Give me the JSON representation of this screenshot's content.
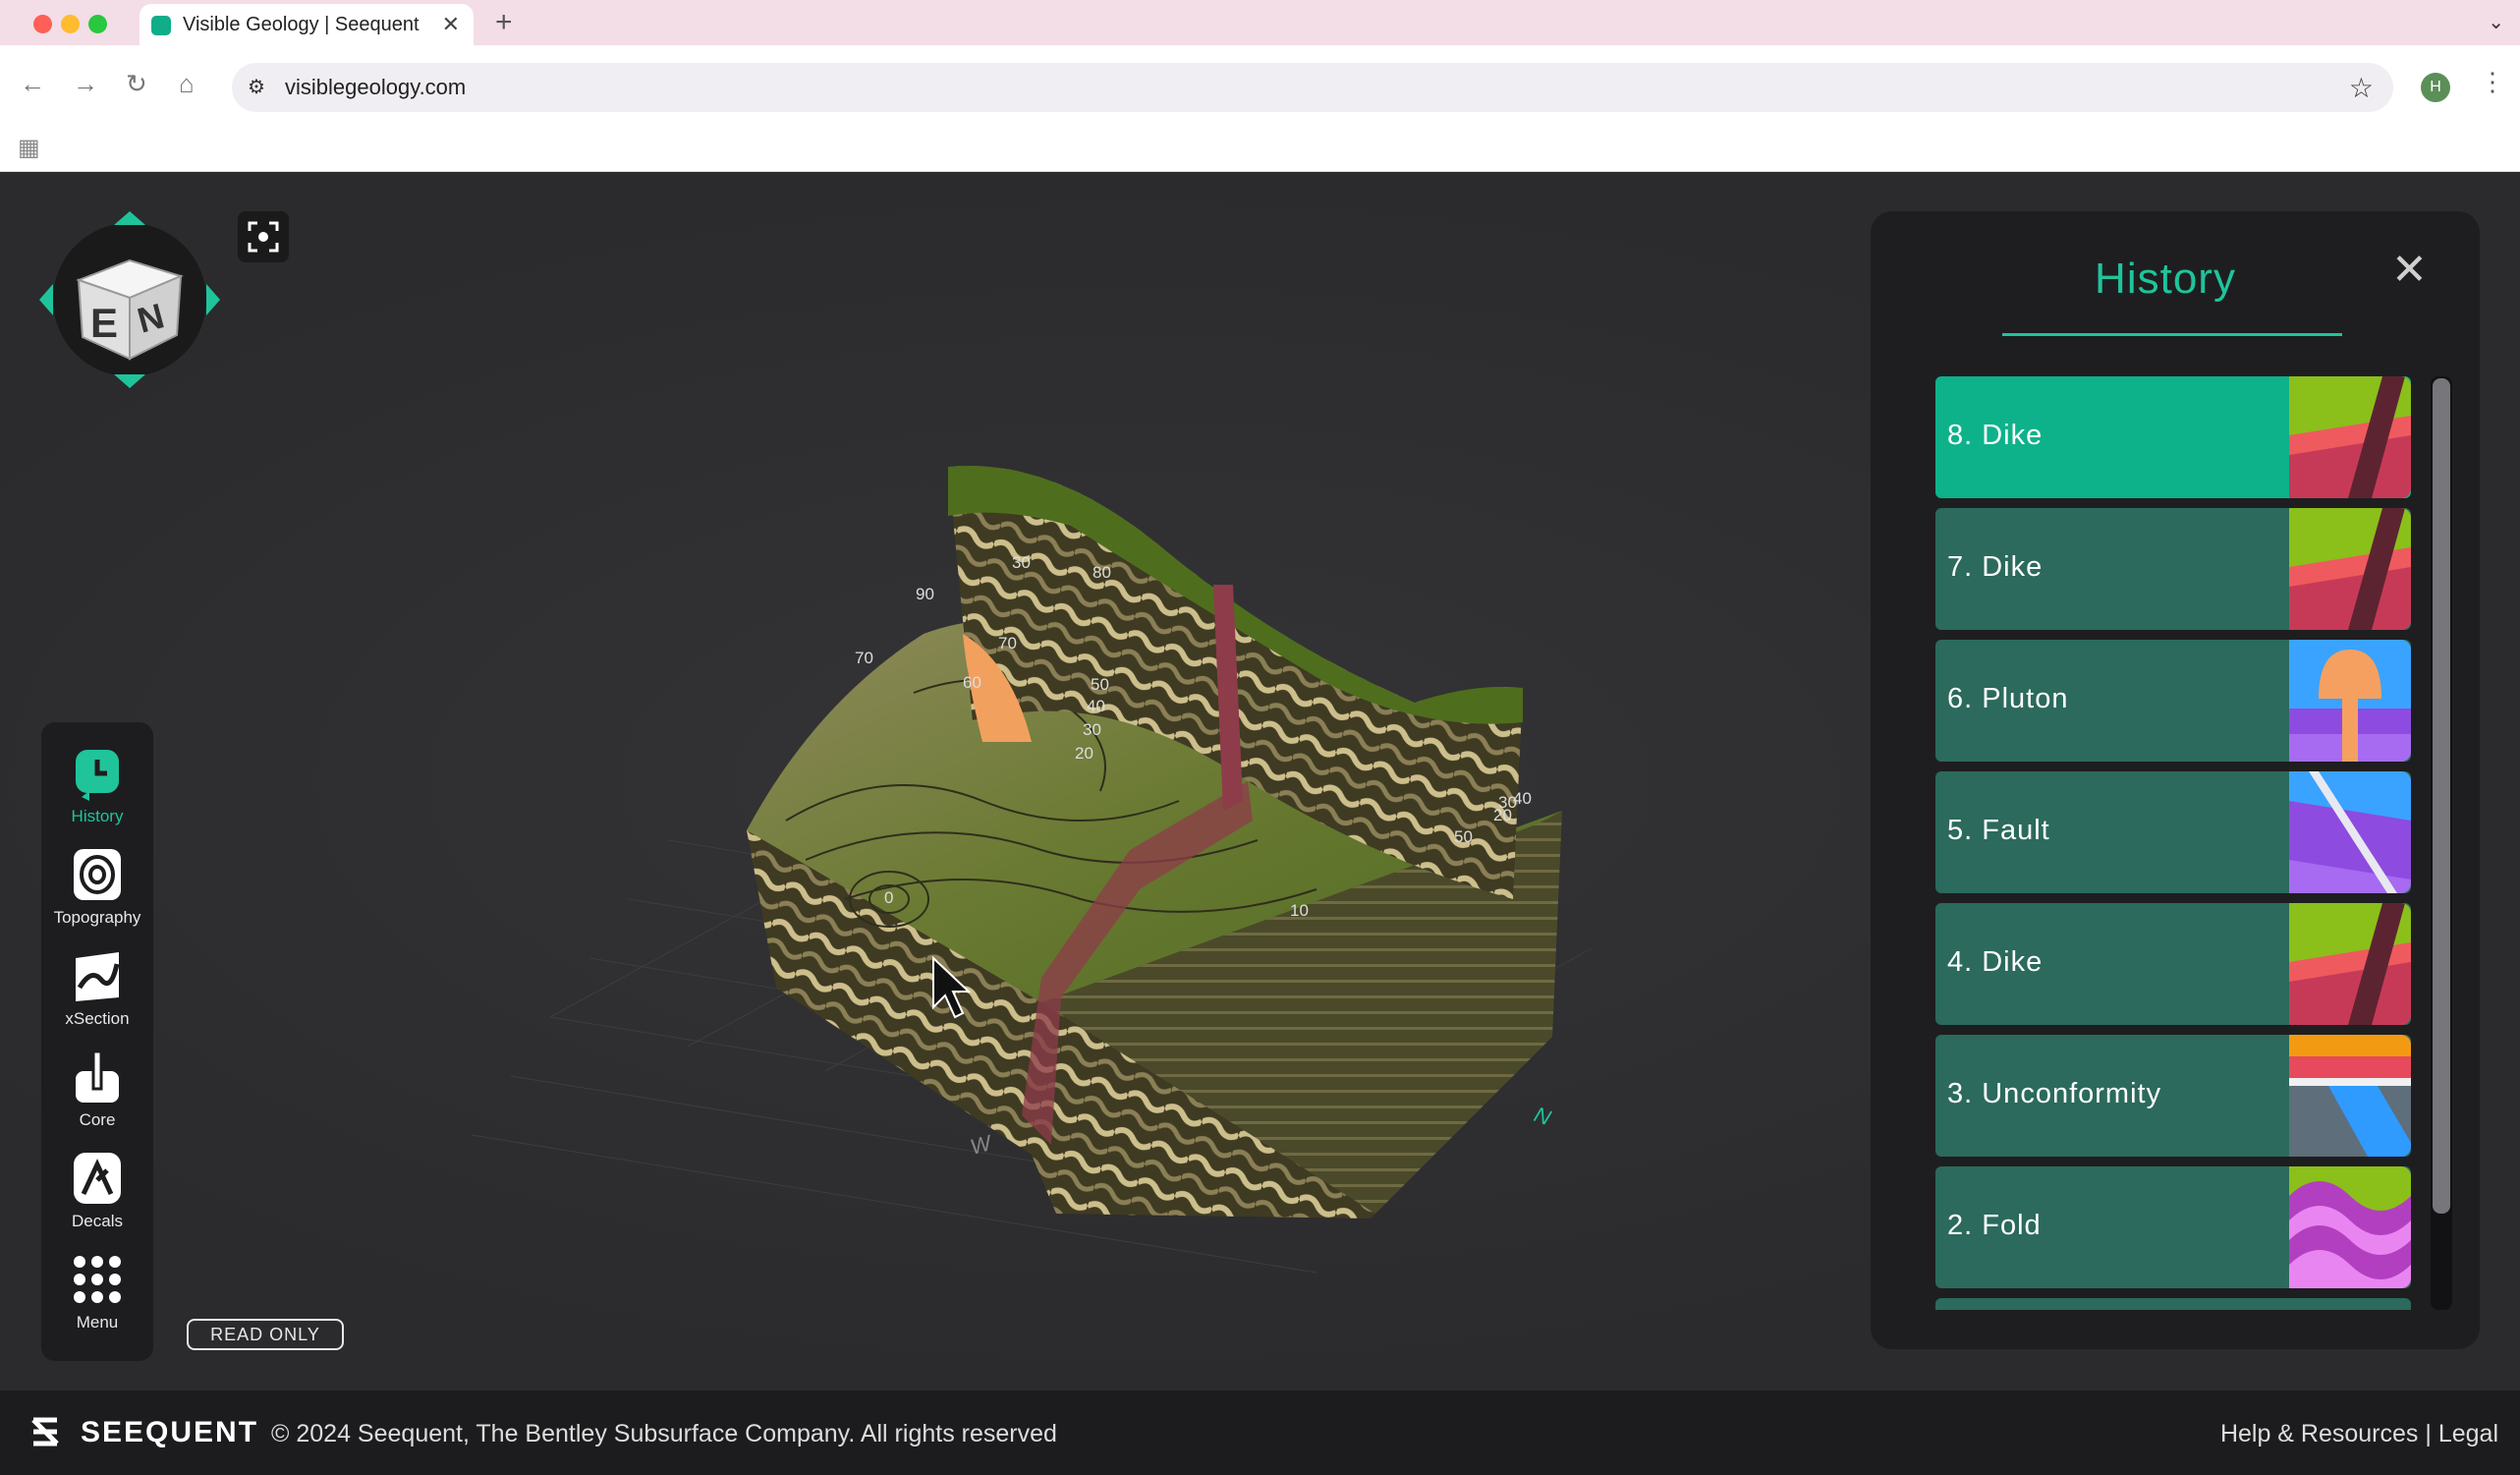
{
  "browser": {
    "tab_title": "Visible Geology | Seequent",
    "tab_close_glyph": "✕",
    "new_tab_glyph": "+",
    "url": "visiblegeology.com",
    "profile_initial": "H",
    "icons": [
      "back-arrow-icon",
      "forward-arrow-icon",
      "reload-icon",
      "home-icon",
      "site-info-icon",
      "star-icon",
      "kebab-menu-icon",
      "apps-grid-icon"
    ]
  },
  "tools": [
    {
      "label": "History",
      "icon": "history-icon",
      "active": true
    },
    {
      "label": "Topography",
      "icon": "topography-icon"
    },
    {
      "label": "xSection",
      "icon": "xsection-icon"
    },
    {
      "label": "Core",
      "icon": "core-icon"
    },
    {
      "label": "Decals",
      "icon": "decals-icon"
    },
    {
      "label": "Menu",
      "icon": "menu-dots-icon"
    }
  ],
  "compass": {
    "faces": [
      "E",
      "N"
    ]
  },
  "scene": {
    "contour_labels": [
      "90",
      "70",
      "70",
      "60",
      "50",
      "40",
      "30",
      "20",
      "80",
      "10",
      "0",
      "50",
      "20",
      "40",
      "30",
      "30"
    ],
    "axis_labels": {
      "west": "W",
      "north": "N"
    }
  },
  "read_only_label": "READ ONLY",
  "history_panel": {
    "title": "History",
    "close_glyph": "✕",
    "items": [
      {
        "label": "8. Dike",
        "kind": "dike",
        "active": true
      },
      {
        "label": "7. Dike",
        "kind": "dike"
      },
      {
        "label": "6. Pluton",
        "kind": "pluton"
      },
      {
        "label": "5. Fault",
        "kind": "fault"
      },
      {
        "label": "4. Dike",
        "kind": "dike"
      },
      {
        "label": "3. Unconformity",
        "kind": "unconformity"
      },
      {
        "label": "2. Fold",
        "kind": "fold"
      }
    ]
  },
  "colors": {
    "accent": "#1fc49b",
    "active_item": "#0db28a",
    "item": "#2b6a5c"
  },
  "footer": {
    "brand": "SEEQUENT",
    "copyright": "© 2024 Seequent, The Bentley Subsurface Company. All rights reserved",
    "links": [
      "Help & Resources",
      "Legal"
    ],
    "separator": "|"
  }
}
